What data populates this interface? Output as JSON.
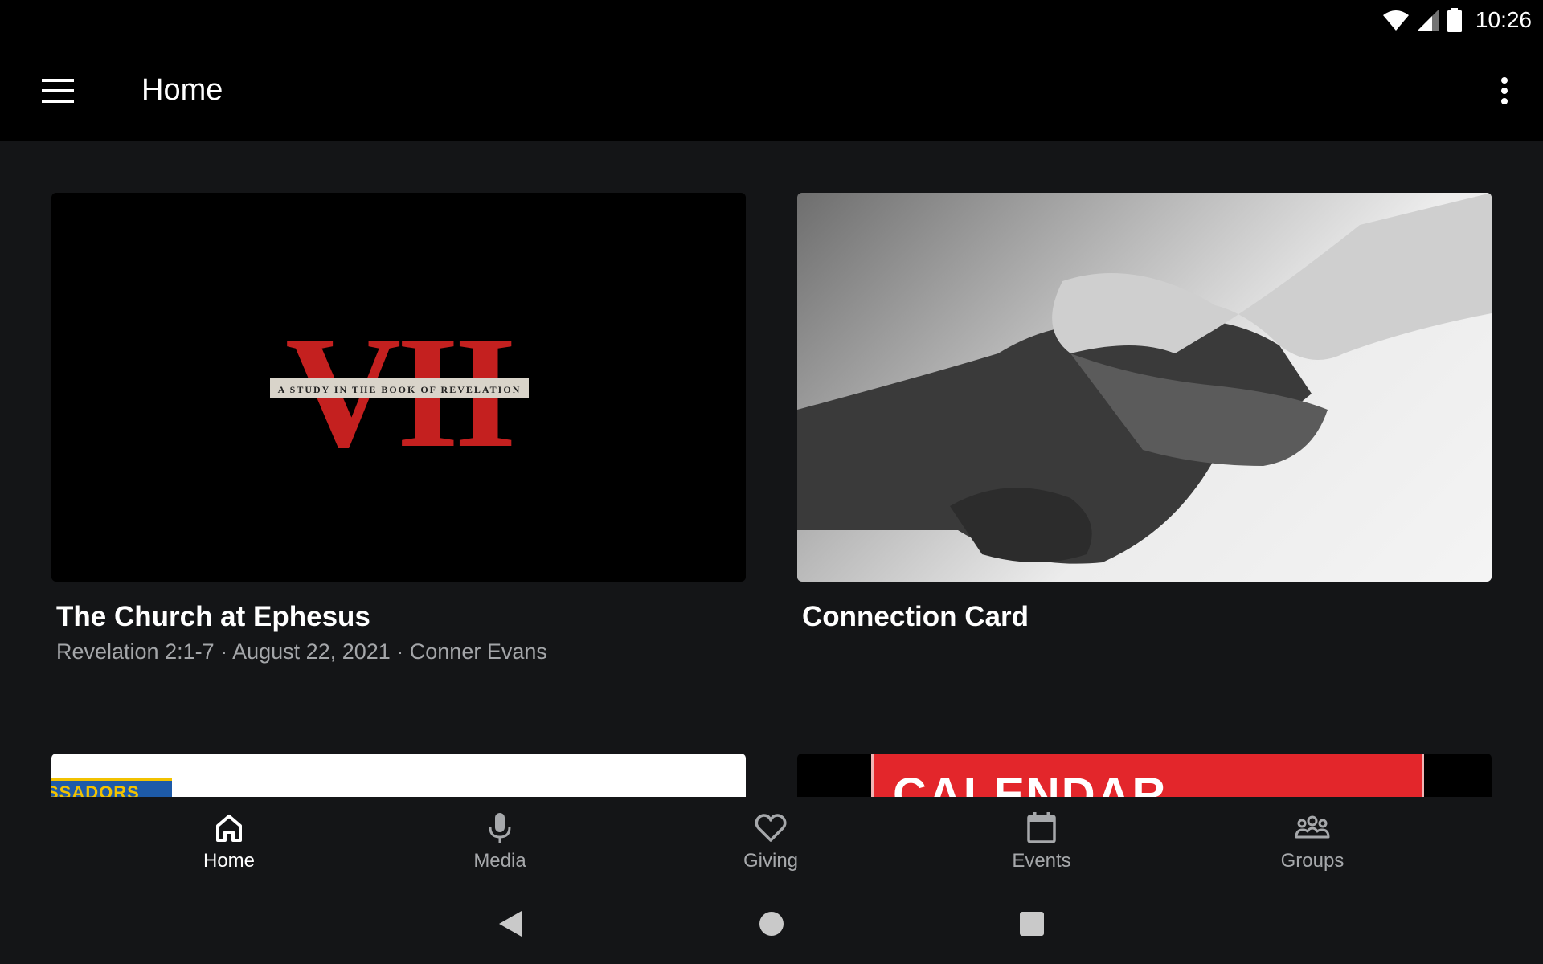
{
  "status_bar": {
    "time": "10:26",
    "icons": [
      "wifi-icon",
      "cell-signal-icon",
      "battery-icon"
    ]
  },
  "app_bar": {
    "title": "Home",
    "menu_icon": "menu-icon",
    "overflow_icon": "more-vert-icon"
  },
  "cards": [
    {
      "title": "The Church at Ephesus",
      "subtitle": "Revelation 2:1-7 · August 22, 2021 · Conner Evans",
      "image": {
        "type": "sermon-series-art",
        "big_text": "VII",
        "banner_text": "A STUDY IN THE BOOK OF REVELATION",
        "accent": "#c4201f"
      }
    },
    {
      "title": "Connection Card",
      "subtitle": "",
      "image": {
        "type": "photo",
        "description": "handshake-photo"
      }
    },
    {
      "title": "",
      "subtitle": "",
      "image": {
        "type": "partial-logo",
        "text": "SSADORS"
      }
    },
    {
      "title": "",
      "subtitle": "",
      "image": {
        "type": "banner",
        "text": "CALENDAR",
        "accent": "#e3262b"
      }
    }
  ],
  "bottom_nav": {
    "items": [
      {
        "label": "Home",
        "icon": "home-icon",
        "active": true
      },
      {
        "label": "Media",
        "icon": "microphone-icon",
        "active": false
      },
      {
        "label": "Giving",
        "icon": "heart-icon",
        "active": false
      },
      {
        "label": "Events",
        "icon": "calendar-icon",
        "active": false
      },
      {
        "label": "Groups",
        "icon": "groups-icon",
        "active": false
      }
    ]
  },
  "system_nav": {
    "buttons": [
      "back-icon",
      "home-circle-icon",
      "recents-icon"
    ]
  },
  "colors": {
    "background": "#141517",
    "bar": "#000000",
    "text": "#ffffff",
    "secondary_text": "#a4a6a9"
  }
}
